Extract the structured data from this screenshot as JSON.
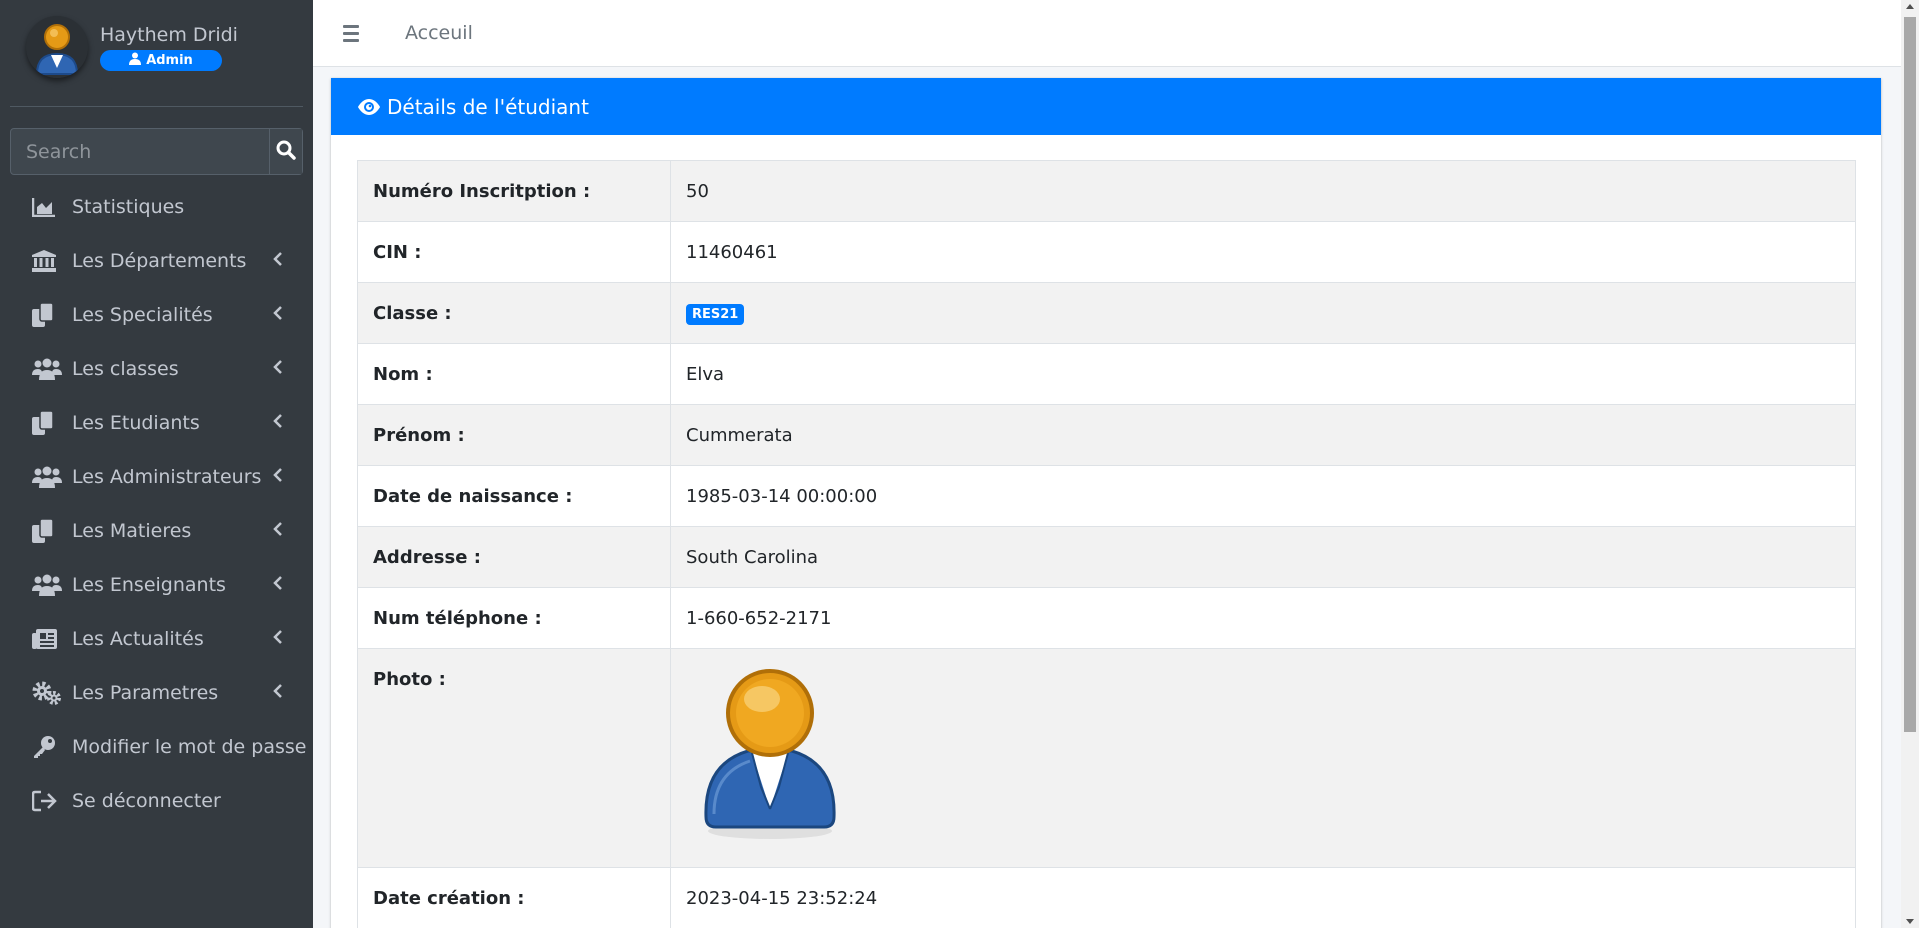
{
  "user": {
    "name": "Haythem Dridi",
    "role": "Admin"
  },
  "search": {
    "placeholder": "Search"
  },
  "nav": [
    {
      "label": "Statistiques",
      "icon": "chart-area-icon",
      "has_children": false
    },
    {
      "label": "Les Départements",
      "icon": "university-icon",
      "has_children": true
    },
    {
      "label": "Les Specialités",
      "icon": "copy-icon",
      "has_children": true
    },
    {
      "label": "Les classes",
      "icon": "users-icon",
      "has_children": true
    },
    {
      "label": "Les Etudiants",
      "icon": "copy-icon",
      "has_children": true
    },
    {
      "label": "Les Administrateurs",
      "icon": "users-icon",
      "has_children": true
    },
    {
      "label": "Les Matieres",
      "icon": "copy-icon",
      "has_children": true
    },
    {
      "label": "Les Enseignants",
      "icon": "users-icon",
      "has_children": true
    },
    {
      "label": "Les Actualités",
      "icon": "newspaper-icon",
      "has_children": true
    },
    {
      "label": "Les Parametres",
      "icon": "cogs-icon",
      "has_children": true
    },
    {
      "label": "Modifier le mot de passe",
      "icon": "key-icon",
      "has_children": false
    },
    {
      "label": "Se déconnecter",
      "icon": "sign-out-icon",
      "has_children": false
    }
  ],
  "topbar": {
    "home_label": "Acceuil"
  },
  "card": {
    "title": "Détails de l'étudiant",
    "rows": [
      {
        "label": "Numéro Inscritption :",
        "value": "50"
      },
      {
        "label": "CIN :",
        "value": "11460461"
      },
      {
        "label": "Classe :",
        "value": "RES21"
      },
      {
        "label": "Nom :",
        "value": "Elva"
      },
      {
        "label": "Prénom :",
        "value": "Cummerata"
      },
      {
        "label": "Date de naissance :",
        "value": "1985-03-14 00:00:00"
      },
      {
        "label": "Addresse :",
        "value": "South Carolina"
      },
      {
        "label": "Num téléphone :",
        "value": "1-660-652-2171"
      },
      {
        "label": "Photo :",
        "value": ""
      },
      {
        "label": "Date création :",
        "value": "2023-04-15 23:52:24"
      }
    ]
  },
  "colors": {
    "primary": "#007bff",
    "sidebar_bg": "#343a40",
    "sidebar_text": "#c2c7d0"
  }
}
